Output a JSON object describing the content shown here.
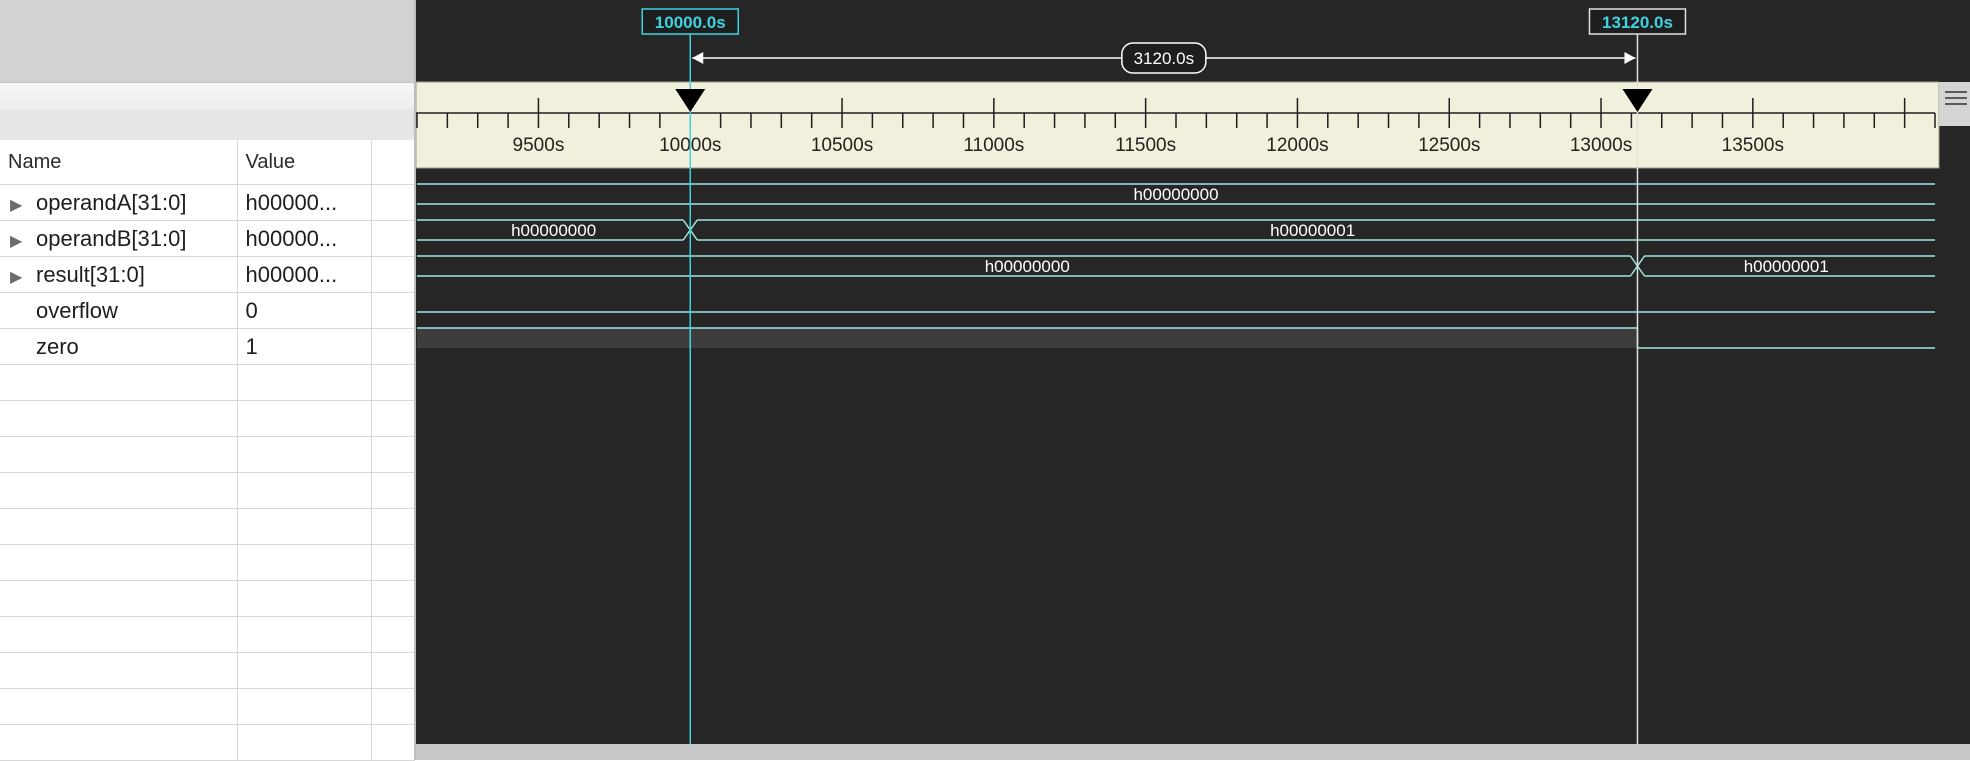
{
  "signal_table": {
    "headers": {
      "name": "Name",
      "value": "Value"
    },
    "rows": [
      {
        "name": "operandA[31:0]",
        "value": "h00000...",
        "expandable": true
      },
      {
        "name": "operandB[31:0]",
        "value": "h00000...",
        "expandable": true
      },
      {
        "name": "result[31:0]",
        "value": "h00000...",
        "expandable": true
      },
      {
        "name": "overflow",
        "value": "0",
        "expandable": false
      },
      {
        "name": "zero",
        "value": "1",
        "expandable": false
      }
    ],
    "empty_rows": 11
  },
  "cursors": {
    "primary": {
      "label": "10000.0s",
      "time": 10000,
      "color": "#3ed3e0"
    },
    "secondary": {
      "label": "13120.0s",
      "time": 13120,
      "color": "#3ed3e0"
    },
    "delta_label": "3120.0s"
  },
  "timeline": {
    "start": 9100,
    "end": 14100,
    "major_step": 500,
    "minor_step": 100,
    "tick_labels": [
      "9500s",
      "10000s",
      "10500s",
      "11000s",
      "11500s",
      "12000s",
      "12500s",
      "13000s",
      "13500s"
    ]
  },
  "waveforms": [
    {
      "signal": "operandA[31:0]",
      "kind": "bus",
      "segments": [
        {
          "from": 9100,
          "to": 14100,
          "label": "h00000000"
        }
      ]
    },
    {
      "signal": "operandB[31:0]",
      "kind": "bus",
      "segments": [
        {
          "from": 9100,
          "to": 10000,
          "label": "h00000000"
        },
        {
          "from": 10000,
          "to": 14100,
          "label": "h00000001"
        }
      ]
    },
    {
      "signal": "result[31:0]",
      "kind": "bus",
      "segments": [
        {
          "from": 9100,
          "to": 13120,
          "label": "h00000000"
        },
        {
          "from": 13120,
          "to": 14100,
          "label": "h00000001"
        }
      ]
    },
    {
      "signal": "overflow",
      "kind": "bit",
      "transitions": [
        {
          "from": 9100,
          "to": 14100,
          "value": 0
        }
      ]
    },
    {
      "signal": "zero",
      "kind": "bit",
      "transitions": [
        {
          "from": 9100,
          "to": 13120,
          "value": 1
        },
        {
          "from": 13120,
          "to": 14100,
          "value": 0
        }
      ]
    }
  ],
  "colors": {
    "wave": "#9fe9e0",
    "background": "#262626",
    "ruler": "#f1f0dc",
    "highlight_row": "#3d3d3d"
  },
  "icons": {
    "expander": "triangle-right-icon",
    "menu": "hamburger-menu-icon",
    "cursor_marker": "triangle-down-icon"
  }
}
